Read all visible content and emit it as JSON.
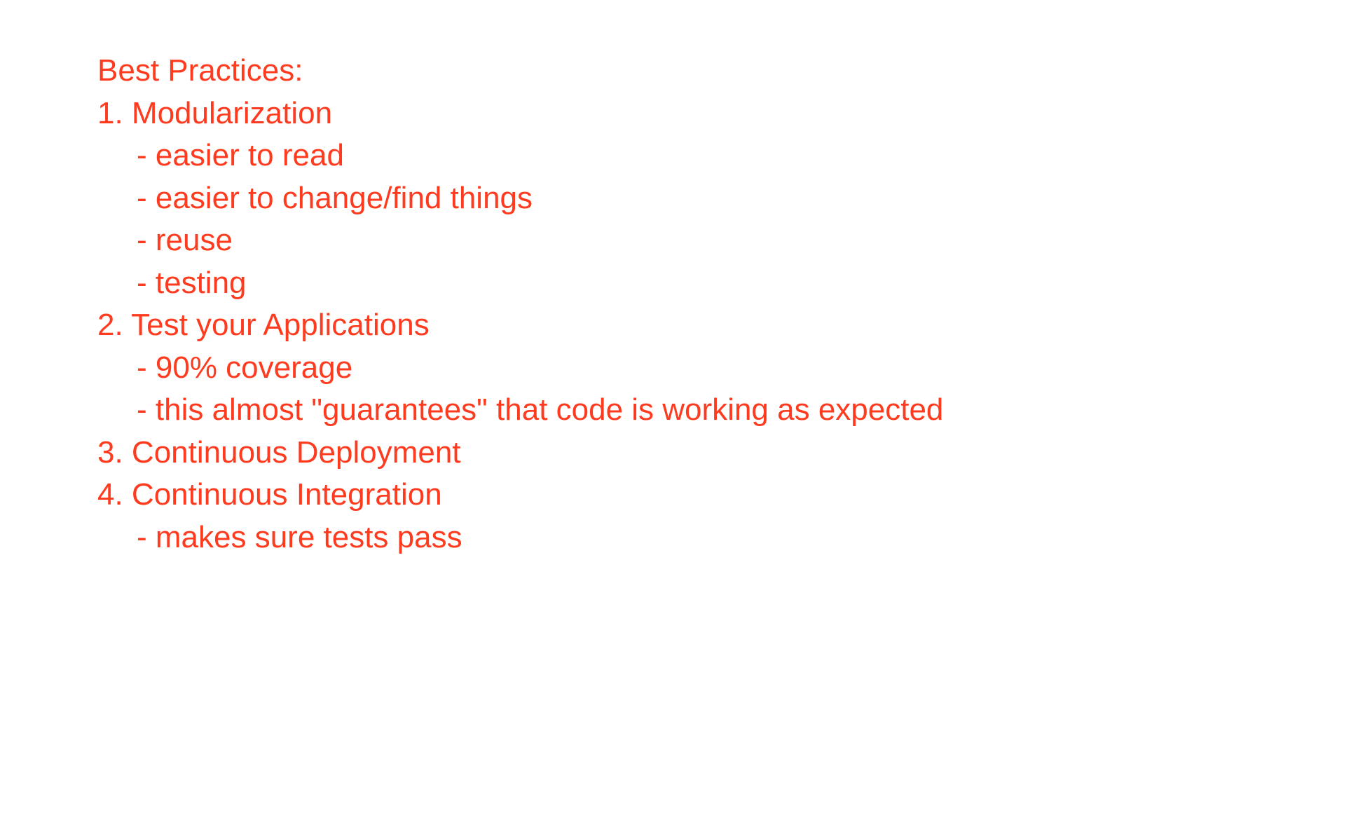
{
  "document": {
    "text_color": "#ff3b1f",
    "background_color": "#ffffff",
    "title": "Best Practices:",
    "items": [
      {
        "label": "1. Modularization",
        "subpoints": [
          "- easier to read",
          "- easier to change/find things",
          "- reuse",
          "- testing"
        ]
      },
      {
        "label": "2. Test your Applications",
        "subpoints": [
          "- 90% coverage",
          "- this almost \"guarantees\" that code is working as expected"
        ]
      },
      {
        "label": "3. Continuous Deployment",
        "subpoints": []
      },
      {
        "label": "4. Continuous Integration",
        "subpoints": [
          "- makes sure tests pass"
        ]
      }
    ]
  }
}
